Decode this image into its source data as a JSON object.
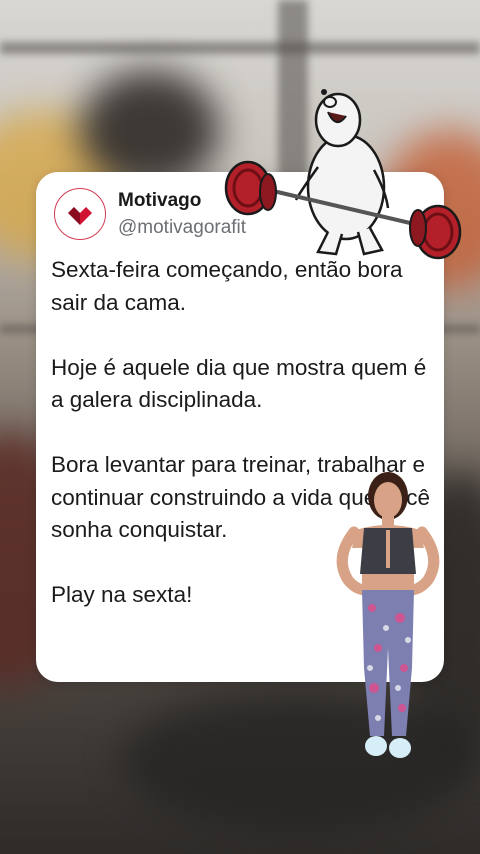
{
  "post": {
    "author_name": "Motivago",
    "author_handle": "@motivagorafit",
    "paragraphs": [
      "Sexta-feira começando, então bora sair da cama.",
      "Hoje é aquele dia que mostra quem é a galera disciplinada.",
      "Bora levantar para treinar, trabalhar e continuar construindo a vida que você sonha conquistar.",
      "Play na sexta!"
    ]
  },
  "avatar": {
    "icon": "heart-logo-icon",
    "color": "#c8102e"
  },
  "stickers": [
    "bear-deadlift-sticker",
    "fitness-woman-sticker"
  ],
  "colors": {
    "card": "#ffffff",
    "text": "#1b1b1b",
    "handle": "#6b6f74",
    "barbell": "#b3202a"
  }
}
